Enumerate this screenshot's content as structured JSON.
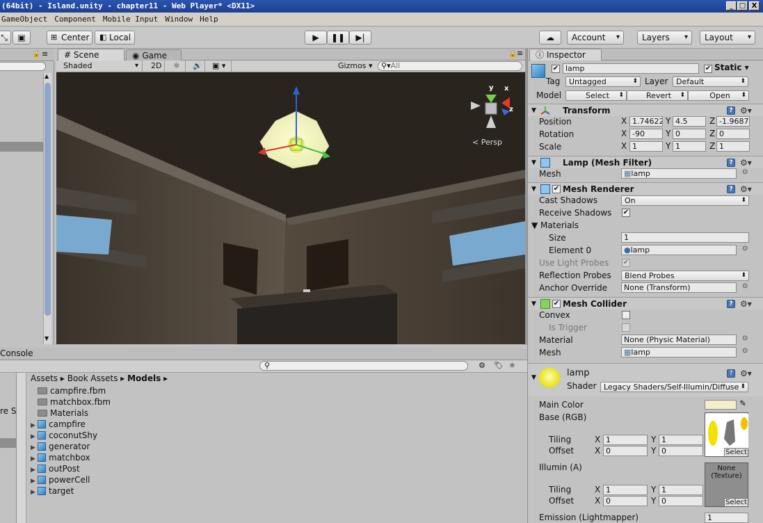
{
  "window": {
    "title": "(64bit) - Island.unity - chapter11 - Web Player* <DX11>",
    "min": "_",
    "max": "□",
    "close": "X"
  },
  "menu": [
    "GameObject",
    "Component",
    "Mobile Input",
    "Window",
    "Help"
  ],
  "toolbar": {
    "pivot": "Center",
    "space": "Local",
    "cloud": "☁",
    "account": "Account",
    "layers": "Layers",
    "layout": "Layout"
  },
  "scene": {
    "tab_scene": "Scene",
    "tab_game": "Game",
    "shading": "Shaded",
    "mode_2d": "2D",
    "gizmos": "Gizmos",
    "search_placeholder": "All",
    "persp": "Persp",
    "gizmo_axes": [
      "y",
      "x",
      "z"
    ]
  },
  "bottom": {
    "console_tab": "Console",
    "left_cut_text": "re S",
    "breadcrumb": [
      "Assets",
      "Book Assets",
      "Models"
    ],
    "assets": [
      {
        "name": "campfire.fbm",
        "type": "folder",
        "expandable": false
      },
      {
        "name": "matchbox.fbm",
        "type": "folder",
        "expandable": false
      },
      {
        "name": "Materials",
        "type": "folder",
        "expandable": false
      },
      {
        "name": "campfire",
        "type": "model",
        "expandable": true
      },
      {
        "name": "coconutShy",
        "type": "model",
        "expandable": true
      },
      {
        "name": "generator",
        "type": "model",
        "expandable": true
      },
      {
        "name": "matchbox",
        "type": "model",
        "expandable": true
      },
      {
        "name": "outPost",
        "type": "model",
        "expandable": true
      },
      {
        "name": "powerCell",
        "type": "model",
        "expandable": true
      },
      {
        "name": "target",
        "type": "model",
        "expandable": true
      }
    ]
  },
  "inspector": {
    "tab": "Inspector",
    "object_name": "lamp",
    "static": "Static",
    "tag_label": "Tag",
    "tag_value": "Untagged",
    "layer_label": "Layer",
    "layer_value": "Default",
    "model_label": "Model",
    "model_select": "Select",
    "model_revert": "Revert",
    "model_open": "Open",
    "transform": {
      "title": "Transform",
      "position_label": "Position",
      "position": {
        "x": "1.74622",
        "y": "4.5",
        "z": "-1.9687"
      },
      "rotation_label": "Rotation",
      "rotation": {
        "x": "-90",
        "y": "0",
        "z": "0"
      },
      "scale_label": "Scale",
      "scale": {
        "x": "1",
        "y": "1",
        "z": "1"
      }
    },
    "mesh_filter": {
      "title": "Lamp (Mesh Filter)",
      "mesh_label": "Mesh",
      "mesh_value": "lamp"
    },
    "mesh_renderer": {
      "title": "Mesh Renderer",
      "cast_shadows_label": "Cast Shadows",
      "cast_shadows_value": "On",
      "receive_shadows_label": "Receive Shadows",
      "materials_label": "Materials",
      "size_label": "Size",
      "size_value": "1",
      "element0_label": "Element 0",
      "element0_value": "lamp",
      "light_probes_label": "Use Light Probes",
      "reflection_label": "Reflection Probes",
      "reflection_value": "Blend Probes",
      "anchor_label": "Anchor Override",
      "anchor_value": "None (Transform)"
    },
    "mesh_collider": {
      "title": "Mesh Collider",
      "convex_label": "Convex",
      "trigger_label": "Is Trigger",
      "material_label": "Material",
      "material_value": "None (Physic Material)",
      "mesh_label": "Mesh",
      "mesh_value": "lamp"
    },
    "material": {
      "name": "lamp",
      "shader_label": "Shader",
      "shader_value": "Legacy Shaders/Self-Illumin/Diffuse",
      "main_color_label": "Main Color",
      "main_color": "#f4eecb",
      "base_label": "Base (RGB)",
      "tiling_label": "Tiling",
      "offset_label": "Offset",
      "base_tiling": {
        "x": "1",
        "y": "1"
      },
      "base_offset": {
        "x": "0",
        "y": "0"
      },
      "illum_label": "Illumin (A)",
      "illum_tex": "None\n(Texture)",
      "illum_tiling": {
        "x": "1",
        "y": "1"
      },
      "illum_offset": {
        "x": "0",
        "y": "0"
      },
      "emission_label": "Emission (Lightmapper)",
      "emission_value": "1",
      "select": "Select"
    }
  },
  "colors": {
    "title_bar": "#2a55b0",
    "panel": "#c2c2c2",
    "accent": "#4a78b4"
  }
}
